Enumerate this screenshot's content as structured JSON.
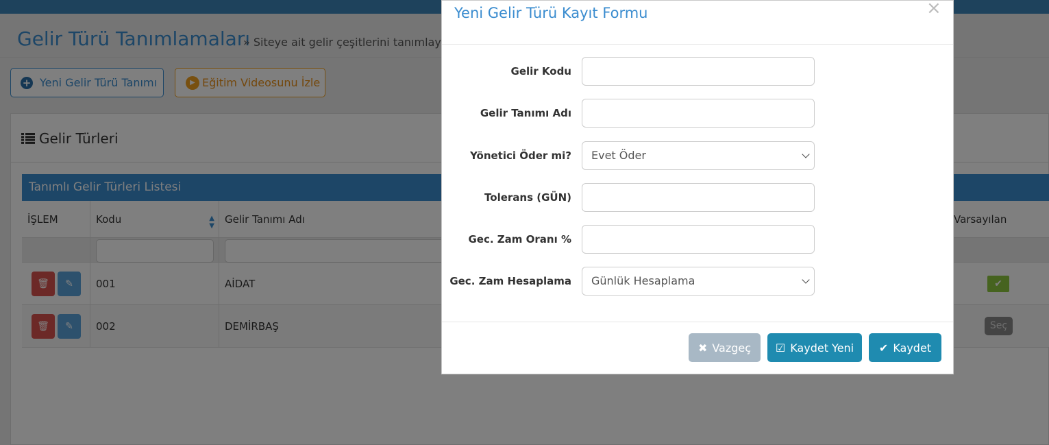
{
  "page": {
    "title": "Gelir Türü Tanımlamaları",
    "subtitle": "» Siteye ait gelir çeşitlerini tanımlayabi"
  },
  "toolbar": {
    "new_label": "Yeni Gelir Türü Tanımı",
    "video_label": "Eğitim Videosunu İzle"
  },
  "panel": {
    "title": "Gelir Türleri",
    "table_caption": "Tanımlı Gelir Türleri Listesi",
    "columns": [
      "İŞLEM",
      "Kodu",
      "Gelir Tanımı Adı",
      "Varsayılan"
    ],
    "rows": [
      {
        "kodu": "001",
        "adi": "AİDAT",
        "varsayilan": "check"
      },
      {
        "kodu": "002",
        "adi": "DEMİRBAŞ",
        "varsayilan": "Seç"
      }
    ]
  },
  "modal": {
    "title": "Yeni Gelir Türü Kayıt Formu",
    "close_symbol": "×",
    "fields": [
      {
        "label": "Gelir Kodu",
        "value": ""
      },
      {
        "label": "Gelir Tanımı Adı",
        "value": ""
      },
      {
        "label": "Yönetici Öder mi?",
        "value": "Evet Öder"
      },
      {
        "label": "Tolerans (GÜN)",
        "value": ""
      },
      {
        "label": "Gec. Zam Oranı %",
        "value": ""
      },
      {
        "label": "Gec. Zam Hesaplama",
        "value": "Günlük Hesaplama"
      }
    ],
    "buttons": {
      "cancel": "Vazgeç",
      "save_new": "Kaydet Yeni",
      "save": "Kaydet"
    }
  },
  "colors": {
    "accent": "#3a8ccf",
    "danger": "#d9534f",
    "success": "#8cc63f",
    "primary_button": "#1f8bb0"
  }
}
